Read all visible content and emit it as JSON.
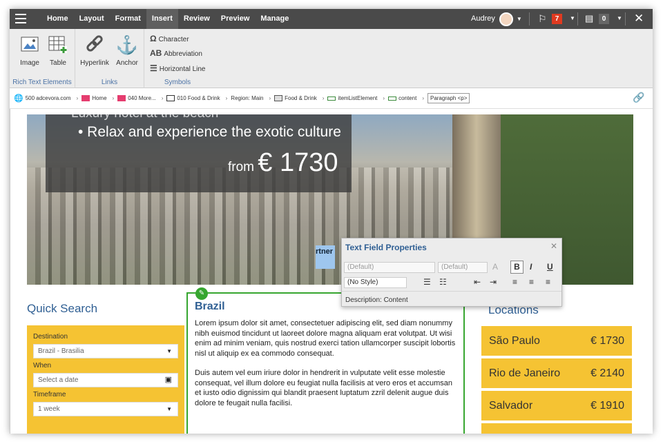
{
  "topbar": {
    "nav": [
      "Home",
      "Layout",
      "Format",
      "Insert",
      "Review",
      "Preview",
      "Manage"
    ],
    "active_nav": "Insert",
    "user": "Audrey",
    "flag_count": "7",
    "tasks_count": "0"
  },
  "ribbon": {
    "rich_text": {
      "title": "Rich Text Elements",
      "image": "Image",
      "table": "Table"
    },
    "links": {
      "title": "Links",
      "hyperlink": "Hyperlink",
      "anchor": "Anchor"
    },
    "symbols": {
      "title": "Symbols",
      "character": "Character",
      "abbreviation": "Abbreviation",
      "horizontal_line": "Horizontal Line"
    }
  },
  "breadcrumb": {
    "items": [
      "500 adcevora.com",
      "Home",
      "040 More...",
      "010 Food & Drink",
      "Region: Main",
      "Food & Drink",
      "itemListElement",
      "content"
    ],
    "current": "Paragraph <p>"
  },
  "hero": {
    "partial_line": "Luxury hotel at the beach",
    "tagline": "• Relax and experience the exotic culture",
    "price_prefix": "from",
    "price": "€ 1730",
    "highlight": "rtner"
  },
  "quick_search": {
    "title": "Quick Search",
    "destination_label": "Destination",
    "destination_value": "Brazil - Brasilia",
    "when_label": "When",
    "when_placeholder": "Select a date",
    "timeframe_label": "Timeframe",
    "timeframe_value": "1 week"
  },
  "article": {
    "title": "Brazil",
    "paragraph_1": "Lorem ipsum dolor sit amet, consectetuer adipiscing elit, sed diam nonummy nibh euismod tincidunt ut laoreet dolore magna aliquam erat volutpat. Ut wisi enim ad minim veniam, quis nostrud exerci tation ullamcorper suscipit lobortis nisl ut aliquip ex ea commodo consequat.",
    "paragraph_2": "Duis autem vel eum iriure dolor in hendrerit in vulputate velit esse molestie consequat, vel illum dolore eu feugiat nulla facilisis at vero eros et accumsan et iusto odio dignissim qui blandit praesent luptatum zzril delenit augue duis dolore te feugait nulla facilisi."
  },
  "locations": {
    "title": "Locations",
    "items": [
      {
        "city": "São Paulo",
        "price": "€ 1730"
      },
      {
        "city": "Rio de Janeiro",
        "price": "€ 2140"
      },
      {
        "city": "Salvador",
        "price": "€ 1910"
      }
    ]
  },
  "popup": {
    "title": "Text Field Properties",
    "font_family": "(Default)",
    "font_size": "(Default)",
    "style": "(No Style)",
    "description": "Description: Content"
  },
  "colors": {
    "topbar": "#4a4a4a",
    "accent": "#2f5f93",
    "highlight_yellow": "#f5c333",
    "edit_green": "#36a62f",
    "badge_red": "#e03a20"
  }
}
